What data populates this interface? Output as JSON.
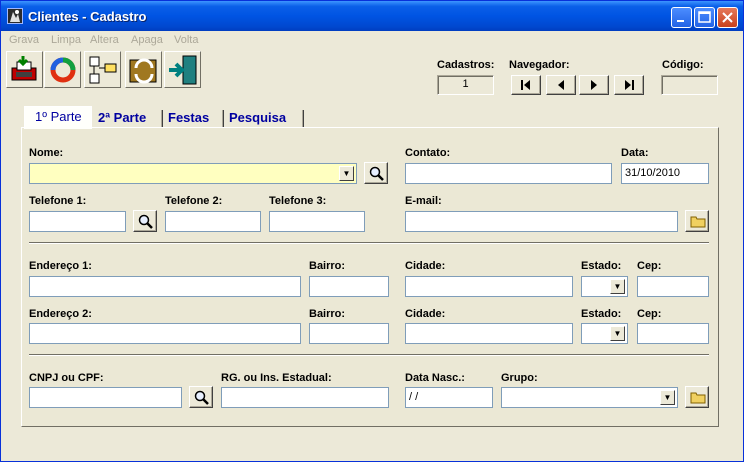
{
  "window": {
    "title": "Clientes - Cadastro"
  },
  "menu": [
    "Grava",
    "Limpa",
    "Altera",
    "Apaga",
    "Volta"
  ],
  "toolbar": {
    "icons": [
      "save-icon",
      "refresh-icon",
      "tree-icon",
      "folder-swap-icon",
      "exit-icon"
    ],
    "cadastros_label": "Cadastros:",
    "cadastros_value": "1",
    "navegador_label": "Navegador:",
    "codigo_label": "Código:",
    "codigo_value": "",
    "nav_buttons": [
      "first",
      "previous",
      "next",
      "last"
    ]
  },
  "tabs": [
    "1º Parte",
    "2ª Parte",
    "Festas",
    "Pesquisa"
  ],
  "form": {
    "nome_label": "Nome:",
    "nome_value": "",
    "contato_label": "Contato:",
    "contato_value": "",
    "data_label": "Data:",
    "data_value": "31/10/2010",
    "tel1_label": "Telefone 1:",
    "tel2_label": "Telefone 2:",
    "tel3_label": "Telefone 3:",
    "email_label": "E-mail:",
    "end1_label": "Endereço 1:",
    "end2_label": "Endereço 2:",
    "bairro_label": "Bairro:",
    "cidade_label": "Cidade:",
    "estado_label": "Estado:",
    "cep_label": "Cep:",
    "cnpj_label": "CNPJ ou CPF:",
    "rg_label": "RG. ou Ins. Estadual:",
    "nasc_label": "Data Nasc.:",
    "nasc_value": " / /",
    "grupo_label": "Grupo:",
    "grupo_value": ""
  }
}
